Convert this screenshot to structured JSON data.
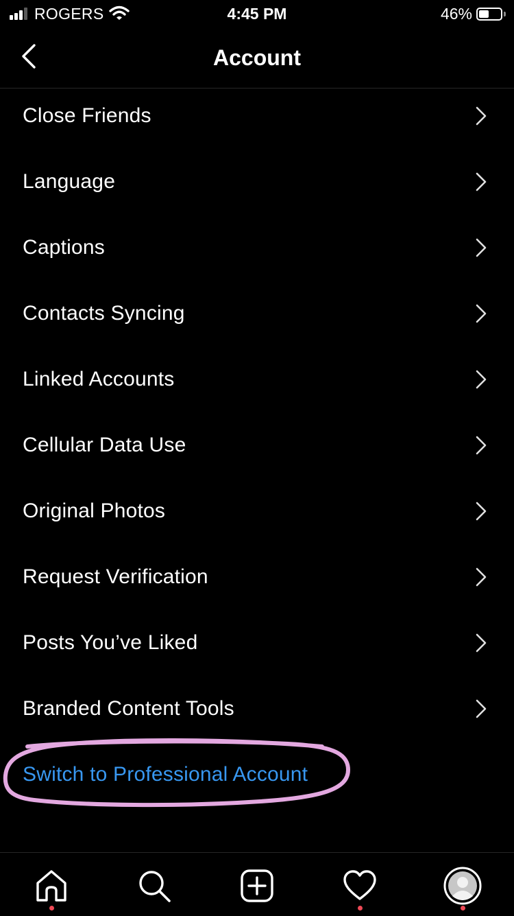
{
  "status_bar": {
    "carrier": "ROGERS",
    "time": "4:45 PM",
    "battery_percent_text": "46%",
    "battery_level": 0.46,
    "signal_bars_active": 3,
    "signal_bars_total": 4
  },
  "header": {
    "title": "Account",
    "back_icon": "chevron-left-icon"
  },
  "menu": {
    "items": [
      {
        "label": "Close Friends"
      },
      {
        "label": "Language"
      },
      {
        "label": "Captions"
      },
      {
        "label": "Contacts Syncing"
      },
      {
        "label": "Linked Accounts"
      },
      {
        "label": "Cellular Data Use"
      },
      {
        "label": "Original Photos"
      },
      {
        "label": "Request Verification"
      },
      {
        "label": "Posts You’ve Liked"
      },
      {
        "label": "Branded Content Tools"
      }
    ],
    "professional_link": "Switch to Professional Account"
  },
  "tab_bar": {
    "tabs": [
      {
        "icon": "home-icon",
        "has_dot": true
      },
      {
        "icon": "search-icon",
        "has_dot": false
      },
      {
        "icon": "add-post-icon",
        "has_dot": false
      },
      {
        "icon": "heart-icon",
        "has_dot": true
      },
      {
        "icon": "profile-avatar-icon",
        "has_dot": true
      }
    ]
  },
  "colors": {
    "background": "#000000",
    "text": "#ffffff",
    "link": "#3897f0",
    "annotation": "#e3a8e0",
    "notification_dot": "#ed4956",
    "divider": "#262626",
    "chevron": "#e0e0e0"
  }
}
